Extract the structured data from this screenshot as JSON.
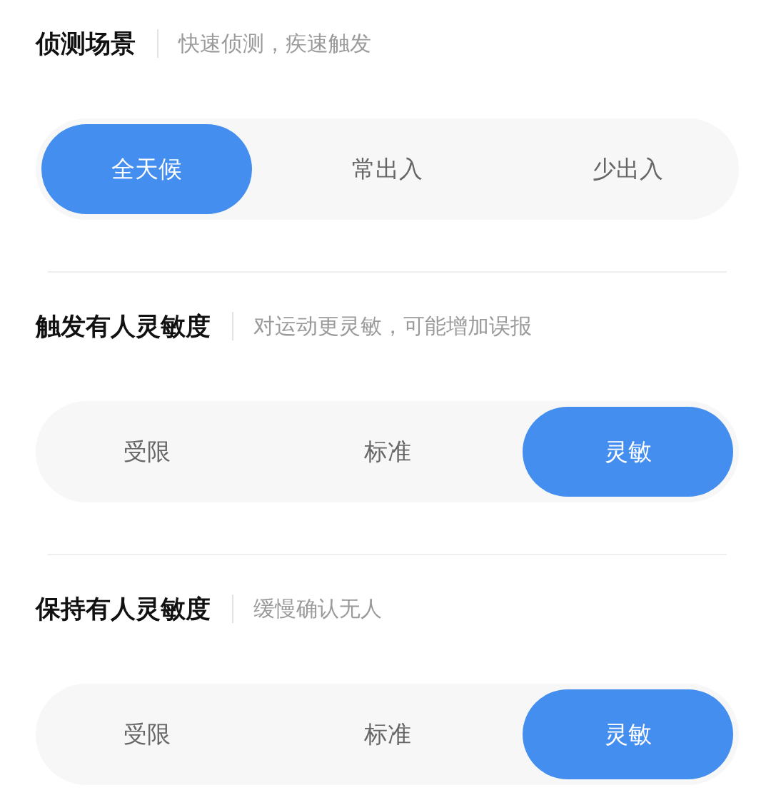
{
  "sections": [
    {
      "title": "侦测场景",
      "subtitle": "快速侦测，疾速触发",
      "options": [
        {
          "label": "全天候",
          "selected": true
        },
        {
          "label": "常出入",
          "selected": false
        },
        {
          "label": "少出入",
          "selected": false
        }
      ]
    },
    {
      "title": "触发有人灵敏度",
      "subtitle": "对运动更灵敏，可能增加误报",
      "options": [
        {
          "label": "受限",
          "selected": false
        },
        {
          "label": "标准",
          "selected": false
        },
        {
          "label": "灵敏",
          "selected": true
        }
      ]
    },
    {
      "title": "保持有人灵敏度",
      "subtitle": "缓慢确认无人",
      "options": [
        {
          "label": "受限",
          "selected": false
        },
        {
          "label": "标准",
          "selected": false
        },
        {
          "label": "灵敏",
          "selected": true
        }
      ]
    }
  ]
}
